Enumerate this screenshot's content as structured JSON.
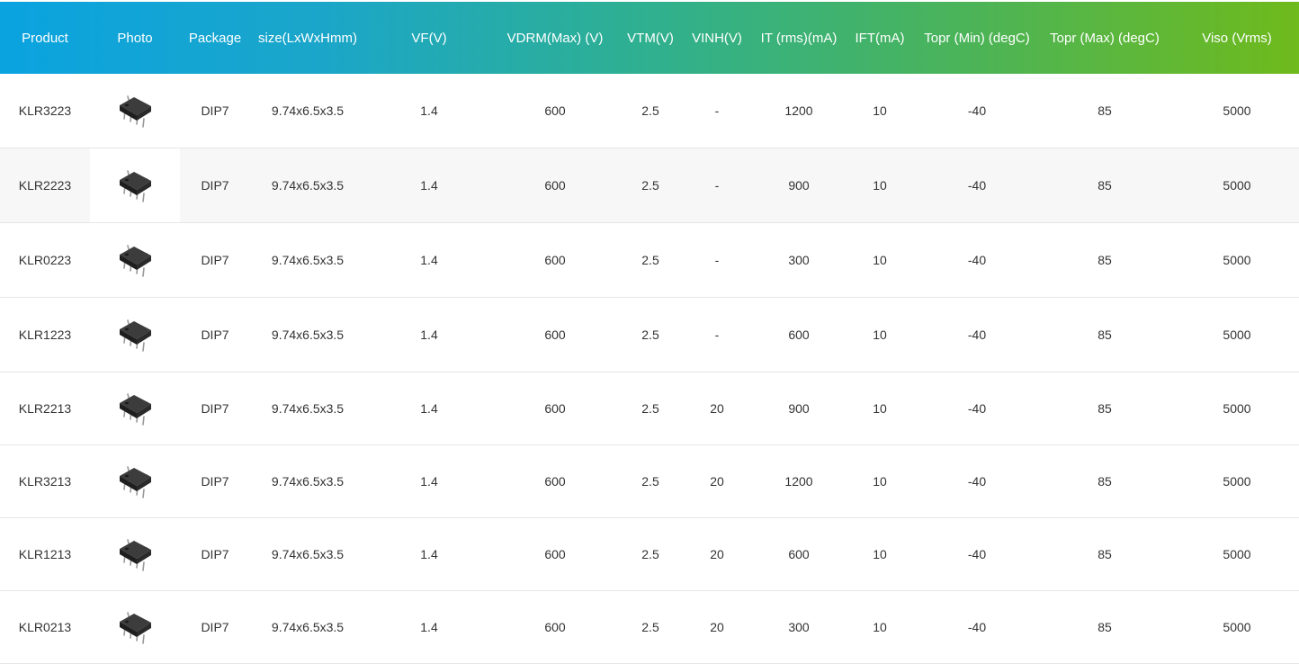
{
  "columns": [
    "Product",
    "Photo",
    "Package",
    "size(LxWxHmm)",
    "VF(V)",
    "VDRM(Max) (V)",
    "VTM(V)",
    "VINH(V)",
    "IT (rms)(mA)",
    "IFT(mA)",
    "Topr (Min) (degC)",
    "Topr (Max) (degC)",
    "Viso (Vrms)"
  ],
  "rows": [
    {
      "product": "KLR3223",
      "package": "DIP7",
      "size": "9.74x6.5x3.5",
      "vf": "1.4",
      "vdrm": "600",
      "vtm": "2.5",
      "vinh": "-",
      "it": "1200",
      "ift": "10",
      "topr_min": "-40",
      "topr_max": "85",
      "viso": "5000"
    },
    {
      "product": "KLR2223",
      "package": "DIP7",
      "size": "9.74x6.5x3.5",
      "vf": "1.4",
      "vdrm": "600",
      "vtm": "2.5",
      "vinh": "-",
      "it": "900",
      "ift": "10",
      "topr_min": "-40",
      "topr_max": "85",
      "viso": "5000"
    },
    {
      "product": "KLR0223",
      "package": "DIP7",
      "size": "9.74x6.5x3.5",
      "vf": "1.4",
      "vdrm": "600",
      "vtm": "2.5",
      "vinh": "-",
      "it": "300",
      "ift": "10",
      "topr_min": "-40",
      "topr_max": "85",
      "viso": "5000"
    },
    {
      "product": "KLR1223",
      "package": "DIP7",
      "size": "9.74x6.5x3.5",
      "vf": "1.4",
      "vdrm": "600",
      "vtm": "2.5",
      "vinh": "-",
      "it": "600",
      "ift": "10",
      "topr_min": "-40",
      "topr_max": "85",
      "viso": "5000"
    },
    {
      "product": "KLR2213",
      "package": "DIP7",
      "size": "9.74x6.5x3.5",
      "vf": "1.4",
      "vdrm": "600",
      "vtm": "2.5",
      "vinh": "20",
      "it": "900",
      "ift": "10",
      "topr_min": "-40",
      "topr_max": "85",
      "viso": "5000"
    },
    {
      "product": "KLR3213",
      "package": "DIP7",
      "size": "9.74x6.5x3.5",
      "vf": "1.4",
      "vdrm": "600",
      "vtm": "2.5",
      "vinh": "20",
      "it": "1200",
      "ift": "10",
      "topr_min": "-40",
      "topr_max": "85",
      "viso": "5000"
    },
    {
      "product": "KLR1213",
      "package": "DIP7",
      "size": "9.74x6.5x3.5",
      "vf": "1.4",
      "vdrm": "600",
      "vtm": "2.5",
      "vinh": "20",
      "it": "600",
      "ift": "10",
      "topr_min": "-40",
      "topr_max": "85",
      "viso": "5000"
    },
    {
      "product": "KLR0213",
      "package": "DIP7",
      "size": "9.74x6.5x3.5",
      "vf": "1.4",
      "vdrm": "600",
      "vtm": "2.5",
      "vinh": "20",
      "it": "300",
      "ift": "10",
      "topr_min": "-40",
      "topr_max": "85",
      "viso": "5000"
    }
  ],
  "photo_icon": "dip-chip-icon",
  "colors": {
    "header_start": "#0aa3e0",
    "header_end": "#6fba1c",
    "header_text": "#ffffff",
    "body_text": "#333333",
    "alt_row": "#f7f7f7",
    "divider": "#e6e6e6"
  }
}
